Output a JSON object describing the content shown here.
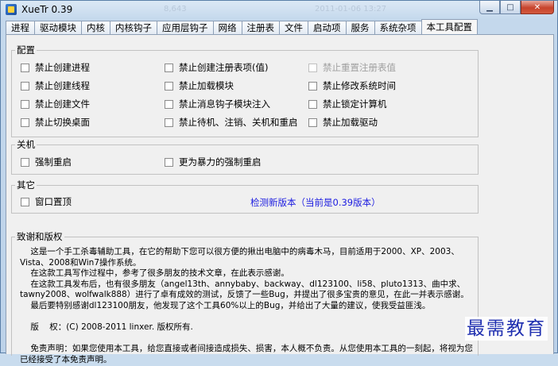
{
  "window": {
    "title": "XueTr 0.39",
    "background_ghost": [
      "8,643",
      "2011-01-06 13:27"
    ],
    "controls": {
      "minimize": "▁",
      "maximize": "□",
      "close": "✕"
    }
  },
  "tabs": [
    {
      "label": "进程"
    },
    {
      "label": "驱动模块"
    },
    {
      "label": "内核"
    },
    {
      "label": "内核钩子"
    },
    {
      "label": "应用层钩子"
    },
    {
      "label": "网络"
    },
    {
      "label": "注册表"
    },
    {
      "label": "文件"
    },
    {
      "label": "启动项"
    },
    {
      "label": "服务"
    },
    {
      "label": "系统杂项"
    },
    {
      "label": "本工具配置",
      "active": true
    }
  ],
  "config": {
    "title": "配置",
    "options": [
      {
        "label": "禁止创建进程",
        "checked": false,
        "enabled": true
      },
      {
        "label": "禁止创建注册表项(值)",
        "checked": false,
        "enabled": true
      },
      {
        "label": "禁止重置注册表值",
        "checked": false,
        "enabled": false
      },
      {
        "label": "禁止创建线程",
        "checked": false,
        "enabled": true
      },
      {
        "label": "禁止加载模块",
        "checked": false,
        "enabled": true
      },
      {
        "label": "禁止修改系统时间",
        "checked": false,
        "enabled": true
      },
      {
        "label": "禁止创建文件",
        "checked": false,
        "enabled": true
      },
      {
        "label": "禁止消息钩子模块注入",
        "checked": false,
        "enabled": true
      },
      {
        "label": "禁止锁定计算机",
        "checked": false,
        "enabled": true
      },
      {
        "label": "禁止切换桌面",
        "checked": false,
        "enabled": true
      },
      {
        "label": "禁止待机、注销、关机和重启",
        "checked": false,
        "enabled": true
      },
      {
        "label": "禁止加载驱动",
        "checked": false,
        "enabled": true
      }
    ]
  },
  "shutdown": {
    "title": "关机",
    "options": [
      {
        "label": "强制重启",
        "checked": false
      },
      {
        "label": "更为暴力的强制重启",
        "checked": false
      }
    ]
  },
  "other": {
    "title": "其它",
    "topmost_label": "窗口置顶",
    "topmost_checked": false,
    "check_version_link": "检测新版本（当前是0.39版本）"
  },
  "acknowledgements": {
    "title": "致谢和版权",
    "text": "    这是一个手工杀毒辅助工具，在它的帮助下您可以很方便的揪出电脑中的病毒木马，目前适用于2000、XP、2003、Vista、2008和Win7操作系统。\n    在这款工具写作过程中，参考了很多朋友的技术文章，在此表示感谢。\n    在这款工具发布后，也有很多朋友（angel13th、annybaby、backway、dl123100、li58、pluto1313、曲中求、tawny2008、wolfwalk888）进行了卓有成效的测试，反馈了一些Bug，并提出了很多宝贵的意见，在此一并表示感谢。\n    最后要特别感谢dl123100朋友，他发现了这个工具60%以上的Bug，并给出了大量的建议，使我受益匪浅。\n\n    版    权：(C) 2008-2011 linxer. 版权所有.\n\n    免责声明：如果您使用本工具，给您直接或者间接造成损失、损害，本人概不负责。从您使用本工具的一刻起，将视为您已经接受了本免责声明。"
  },
  "watermark": "最需教育"
}
